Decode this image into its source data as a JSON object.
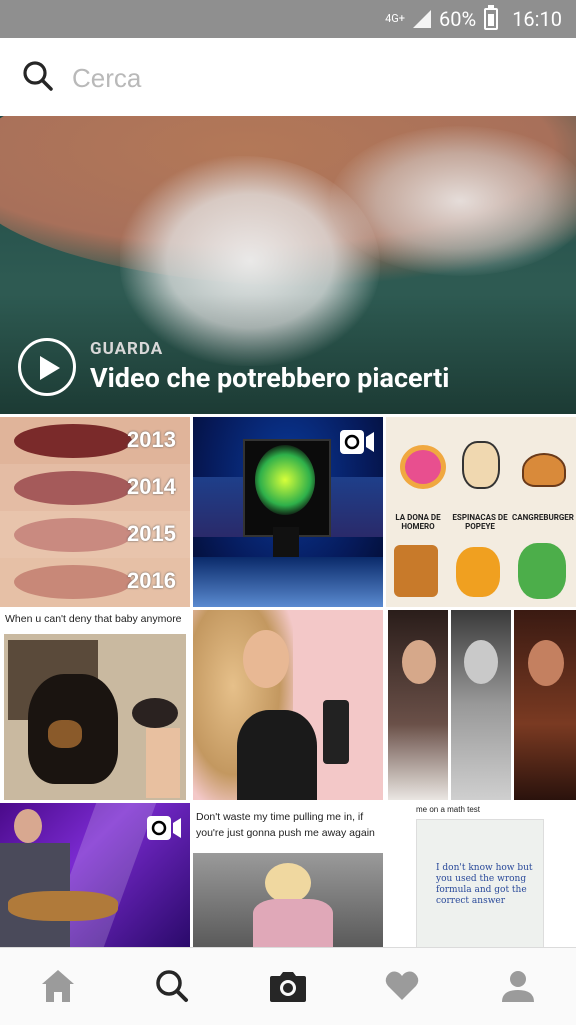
{
  "status_bar": {
    "network": "4G+",
    "battery": "60%",
    "time": "16:10"
  },
  "search": {
    "placeholder": "Cerca",
    "value": ""
  },
  "hero": {
    "kicker": "GUARDA",
    "title": "Video che potrebbero piacerti"
  },
  "tiles": {
    "lips": {
      "years": [
        "2013",
        "2014",
        "2015",
        "2016"
      ]
    },
    "cartoons": {
      "labels": [
        "LA DONA DE HOMERO",
        "ESPINACAS DE POPEYE",
        "CANGREBURGER"
      ]
    },
    "rottweiler": {
      "caption": "When u can't deny that baby anymore"
    },
    "quote": {
      "caption": "Don't waste my time pulling me in, if you're just gonna push me away again"
    },
    "math": {
      "caption": "me on a math test",
      "note": "I don't know how but you used the wrong formula and got the correct answer"
    }
  },
  "icons": {
    "nav": [
      "home-icon",
      "search-icon",
      "camera-icon",
      "heart-icon",
      "profile-icon"
    ],
    "video_badge": "video-camera-icon"
  },
  "colors": {
    "status_bar": "#8f8f8f",
    "nav_active": "#262626",
    "nav_inactive": "#9b9b9b"
  }
}
